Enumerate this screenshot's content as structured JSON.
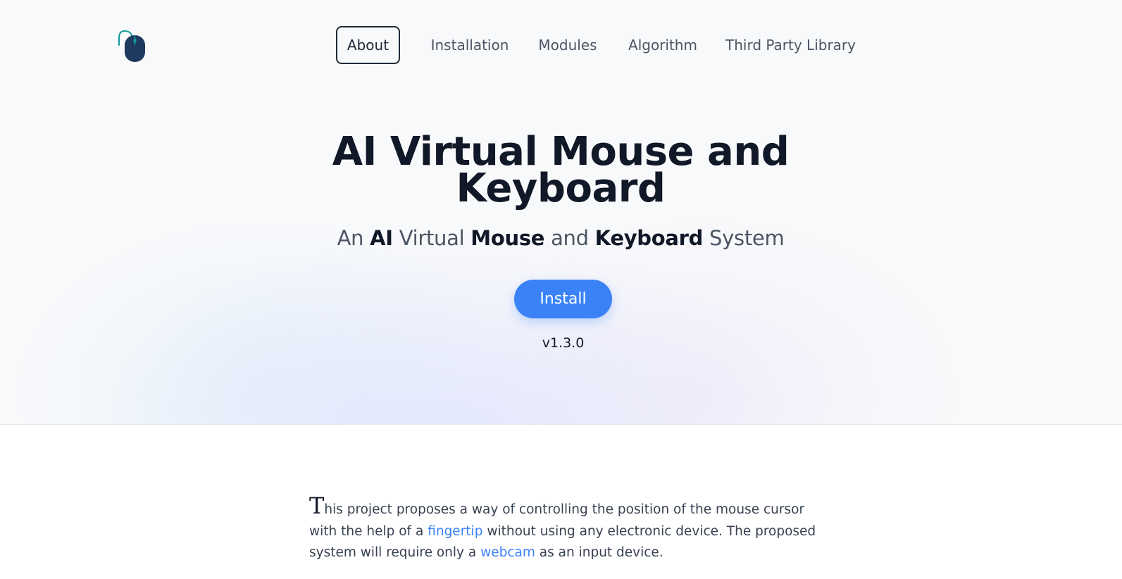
{
  "header": {
    "logo_icon": "mouse-icon",
    "nav": [
      {
        "label": "About",
        "active": true
      },
      {
        "label": "Installation",
        "active": false
      },
      {
        "label": "Modules",
        "active": false
      },
      {
        "label": "Algorithm",
        "active": false
      },
      {
        "label": "Third Party Library",
        "active": false
      }
    ]
  },
  "hero": {
    "title": "AI Virtual Mouse and Keyboard",
    "subtitle": {
      "w1": "An",
      "w2": "AI",
      "w3": "Virtual",
      "w4": "Mouse",
      "w5": "and",
      "w6": "Keyboard",
      "w7": "System"
    },
    "install_label": "Install",
    "version": "v1.3.0"
  },
  "about": {
    "dropcap": "T",
    "text_1": "his project proposes a way of controlling the position of the mouse cursor with the help of a",
    "link_1": "fingertip",
    "text_2": "without using any electronic device. The proposed system will require only a",
    "link_2": "webcam",
    "text_3": "as an input device."
  },
  "colors": {
    "accent": "#3b82f6",
    "title": "#111827",
    "nav_text": "#4b5563",
    "logo_body": "#1e3a5f",
    "logo_cable": "#0f9a9a"
  }
}
